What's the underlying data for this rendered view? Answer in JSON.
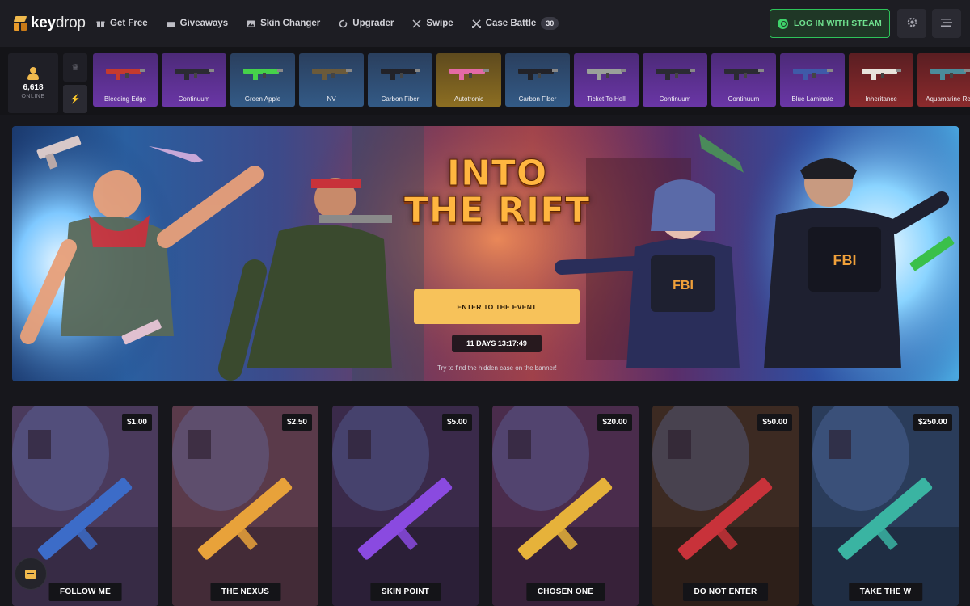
{
  "brand": {
    "name_left": "key",
    "name_right": "drop"
  },
  "nav": [
    {
      "label": "Get Free",
      "icon": "gift-icon"
    },
    {
      "label": "Giveaways",
      "icon": "present-icon"
    },
    {
      "label": "Skin Changer",
      "icon": "image-icon"
    },
    {
      "label": "Upgrader",
      "icon": "refresh-icon"
    },
    {
      "label": "Swipe",
      "icon": "swipe-icon"
    },
    {
      "label": "Case Battle",
      "icon": "swords-icon",
      "badge": "30"
    }
  ],
  "header": {
    "login_label": "LOG IN WITH STEAM",
    "settings_icon": "gear-icon",
    "menu_icon": "hamburger-icon"
  },
  "online": {
    "count": "6,618",
    "label": "ONLINE"
  },
  "drops": [
    {
      "name": "Bleeding Edge",
      "rarity": "purple",
      "gun_color": "#c43a2e"
    },
    {
      "name": "Continuum",
      "rarity": "purple",
      "gun_color": "#2b2b33"
    },
    {
      "name": "Green Apple",
      "rarity": "blue",
      "gun_color": "#46d24a"
    },
    {
      "name": "NV",
      "rarity": "blue",
      "gun_color": "#6b5a3a"
    },
    {
      "name": "Carbon Fiber",
      "rarity": "blue",
      "gun_color": "#222228"
    },
    {
      "name": "Autotronic",
      "rarity": "gold",
      "gun_color": "#e46aa6"
    },
    {
      "name": "Carbon Fiber",
      "rarity": "blue",
      "gun_color": "#222228"
    },
    {
      "name": "Ticket To Hell",
      "rarity": "purple",
      "gun_color": "#9aa09a"
    },
    {
      "name": "Continuum",
      "rarity": "purple",
      "gun_color": "#2b2b33"
    },
    {
      "name": "Continuum",
      "rarity": "purple",
      "gun_color": "#2b2b33"
    },
    {
      "name": "Blue Laminate",
      "rarity": "purple",
      "gun_color": "#3f5aa8"
    },
    {
      "name": "Inheritance",
      "rarity": "red",
      "gun_color": "#e8e4dc"
    },
    {
      "name": "Aquamarine Rev",
      "rarity": "red",
      "gun_color": "#4b8c9a"
    }
  ],
  "hero": {
    "title_line1": "INTO",
    "title_line2": "THE RIFT",
    "cta": "ENTER TO THE EVENT",
    "timer": "11 DAYS 13:17:49",
    "hint": "Try to find the hidden case on the banner!"
  },
  "cases": [
    {
      "name": "FOLLOW ME",
      "price": "$1.00",
      "bg": "#4a3a5c",
      "accent": "#3c6cc8"
    },
    {
      "name": "THE NEXUS",
      "price": "$2.50",
      "bg": "#5a3a4a",
      "accent": "#e8a23a"
    },
    {
      "name": "SKIN POINT",
      "price": "$5.00",
      "bg": "#3a2a4a",
      "accent": "#8a4ae0"
    },
    {
      "name": "CHOSEN ONE",
      "price": "$20.00",
      "bg": "#4a2c4c",
      "accent": "#e6b23a"
    },
    {
      "name": "DO NOT ENTER",
      "price": "$50.00",
      "bg": "#3c2a22",
      "accent": "#c8323a"
    },
    {
      "name": "TAKE THE W",
      "price": "$250.00",
      "bg": "#2a3c5a",
      "accent": "#3ab4a2"
    }
  ],
  "chat": {
    "icon": "chat-icon"
  }
}
